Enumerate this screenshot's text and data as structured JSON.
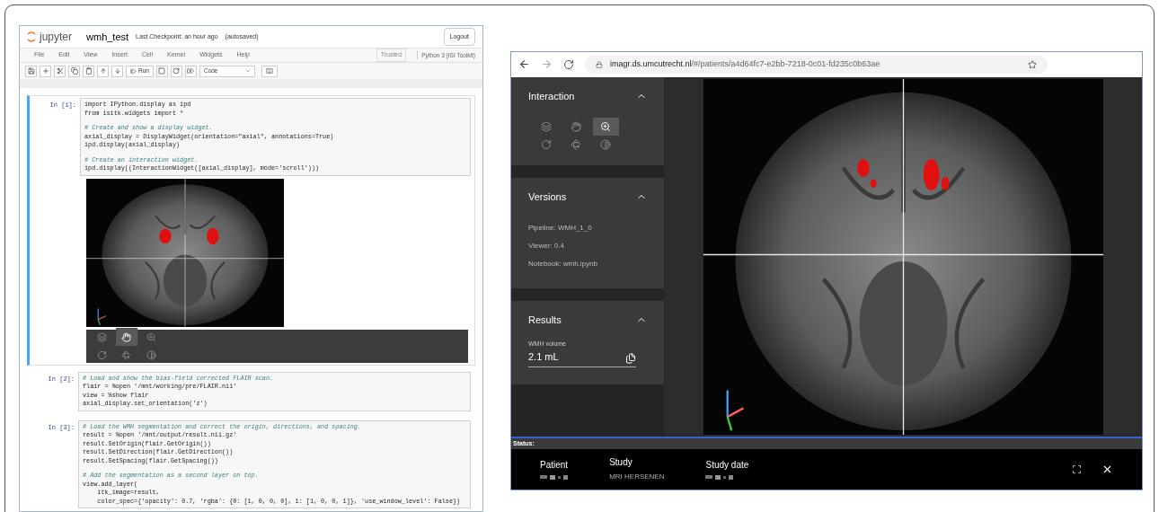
{
  "notebook": {
    "logo": "jupyter",
    "title": "wmh_test",
    "checkpoint": "Last Checkpoint: an hour ago",
    "autosave": "(autosaved)",
    "logout": "Logout",
    "menu": [
      "File",
      "Edit",
      "View",
      "Insert",
      "Cell",
      "Kernel",
      "Widgets",
      "Help"
    ],
    "trusted": "Trusted",
    "kernel": "Python 3 (ISI Toolkit)",
    "run": "Run",
    "cell_type": "Code",
    "cells": [
      {
        "prompt": "In [1]:",
        "lines": [
          {
            "kind": "code",
            "text": "import IPython.display as ipd"
          },
          {
            "kind": "code",
            "text": "from isitk.widgets import *"
          },
          {
            "kind": "blank"
          },
          {
            "kind": "comment",
            "text": "# Create and show a display widget."
          },
          {
            "kind": "code",
            "text": "axial_display = DisplayWidget(orientation=\"axial\", annotations=True)"
          },
          {
            "kind": "code",
            "text": "ipd.display(axial_display)"
          },
          {
            "kind": "blank"
          },
          {
            "kind": "comment",
            "text": "# Create an interaction widget."
          },
          {
            "kind": "code",
            "text": "ipd.display((InteractionWidget([axial_display], mode='scroll')))"
          }
        ],
        "output": {
          "tools": [
            {
              "kind": "layers",
              "selected": false
            },
            {
              "kind": "hand",
              "selected": true
            },
            {
              "kind": "zoom",
              "selected": false
            },
            {
              "kind": "rotate",
              "selected": false
            },
            {
              "kind": "rotate3d",
              "selected": false
            },
            {
              "kind": "contrast",
              "selected": false
            }
          ]
        }
      },
      {
        "prompt": "In [2]:",
        "lines": [
          {
            "kind": "comment",
            "text": "# Load and show the bias-field corrected FLAIR scan."
          },
          {
            "kind": "code",
            "text": "flair = %open '/mnt/working/pre/FLAIR.nii'"
          },
          {
            "kind": "code",
            "text": "view = %show flair"
          },
          {
            "kind": "code",
            "text": "axial_display.set_orientation('z')"
          }
        ]
      },
      {
        "prompt": "In [3]:",
        "lines": [
          {
            "kind": "comment",
            "text": "# Load the WMH segmentation and correct the origin, directions, and spacing."
          },
          {
            "kind": "code",
            "text": "result = %open '/mnt/output/result.nii.gz'"
          },
          {
            "kind": "code",
            "text": "result.SetOrigin(flair.GetOrigin())"
          },
          {
            "kind": "code",
            "text": "result.SetDirection(flair.GetDirection())"
          },
          {
            "kind": "code",
            "text": "result.SetSpacing(flair.GetSpacing())"
          },
          {
            "kind": "blank"
          },
          {
            "kind": "comment",
            "text": "# Add the segmentation as a second layer on top."
          },
          {
            "kind": "code",
            "text": "view.add_layer("
          },
          {
            "kind": "code",
            "text": "    itk_image=result,"
          },
          {
            "kind": "code",
            "text": "    color_spec={'opacity': 0.7, 'rgba': {0: [1, 0, 0, 0], 1: [1, 0, 0, 1]}, 'use_window_level': False})"
          }
        ]
      }
    ]
  },
  "viewer": {
    "url_host": "imagr.ds.umcutrecht.nl",
    "url_path": "/#/patients/a4d64fc7-e2bb-7218-0c01-fd235c0b63ae",
    "sections": [
      {
        "kind": "tools",
        "title": "Interaction",
        "expanded": true,
        "tools": [
          {
            "kind": "layers",
            "selected": false
          },
          {
            "kind": "hand",
            "selected": false
          },
          {
            "kind": "zoom",
            "selected": true
          },
          {
            "kind": "rotate",
            "selected": false
          },
          {
            "kind": "rotate3d",
            "selected": false
          },
          {
            "kind": "contrast",
            "selected": false
          }
        ]
      },
      {
        "kind": "info",
        "title": "Versions",
        "expanded": true,
        "lines": [
          "Pipeline: WMH_1_0",
          "Viewer: 0.4",
          "Notebook: wmh.ipynb"
        ]
      },
      {
        "kind": "result",
        "title": "Results",
        "expanded": true,
        "label": "WMH volume",
        "value": "2.1 mL"
      }
    ],
    "status_label": "Status:",
    "status": [
      {
        "label": "Patient",
        "redacted": true
      },
      {
        "label": "Study",
        "value": "MRI HERSENEN",
        "redacted": false
      },
      {
        "label": "Study date",
        "redacted": true
      }
    ]
  }
}
